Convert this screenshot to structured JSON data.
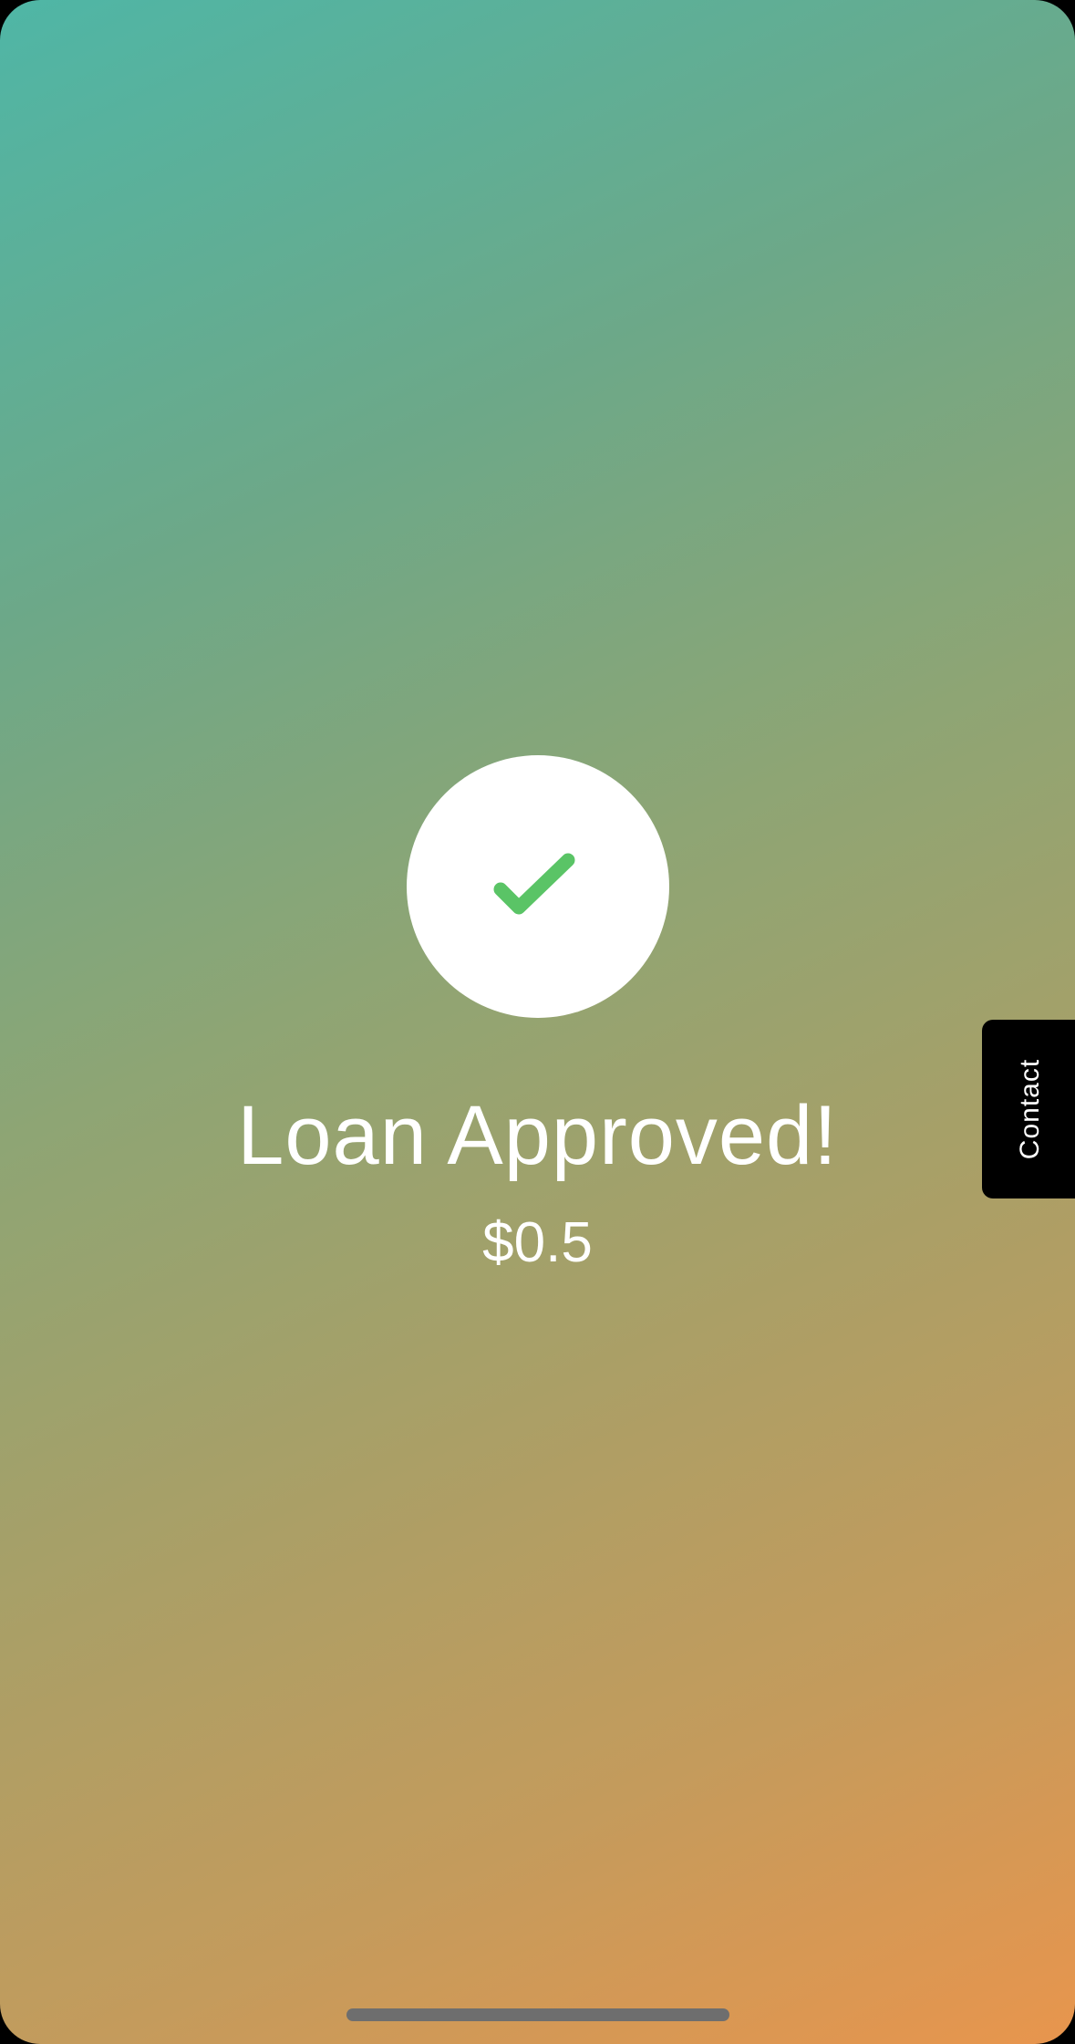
{
  "status": {
    "title": "Loan Approved!",
    "amount": "$0.5",
    "icon": "check-icon"
  },
  "contact_tab": {
    "label": "Contact"
  },
  "colors": {
    "gradient_start": "#4fb6a6",
    "gradient_end": "#e8954d",
    "check": "#5ac466",
    "tab_background": "#000000",
    "text": "#ffffff"
  }
}
